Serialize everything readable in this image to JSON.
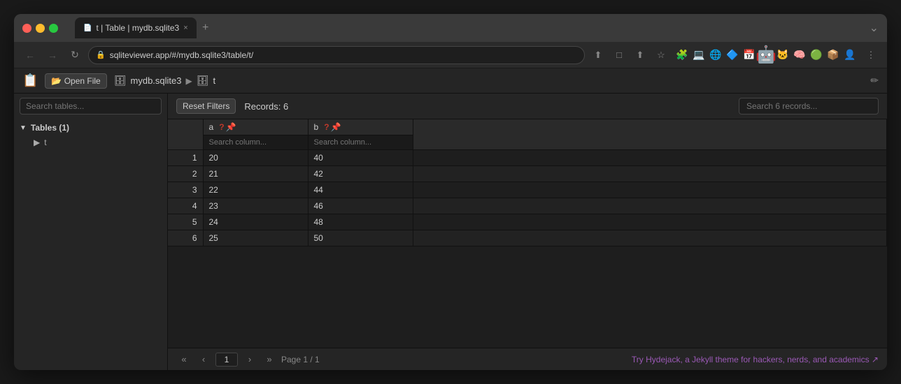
{
  "browser": {
    "tab": {
      "icon": "📄",
      "title": "t | Table | mydb.sqlite3",
      "close": "×"
    },
    "new_tab_label": "+",
    "window_control_label": "⌄",
    "nav": {
      "back": "←",
      "forward": "→",
      "reload": "↻",
      "address": "sqliteviewer.app/#/mydb.sqlite3/table/t/",
      "share1": "⬆",
      "share2": "□",
      "share3": "⬆",
      "star": "☆",
      "more": "⋮"
    }
  },
  "app": {
    "logo": "📋",
    "open_file_label": "📂 Open File",
    "breadcrumb": {
      "db": "mydb.sqlite3",
      "db_icon": "🗄",
      "sep": "▶",
      "table_icon": "🗄",
      "table": "t"
    },
    "edit_icon": "✏"
  },
  "sidebar": {
    "search_placeholder": "Search tables...",
    "tables_group": "Tables (1)",
    "tables": [
      {
        "name": "t"
      }
    ]
  },
  "toolbar": {
    "reset_filters": "Reset Filters",
    "records_count": "Records: 6",
    "search_placeholder": "Search 6 records..."
  },
  "columns": [
    {
      "name": "a",
      "search_placeholder": "Search column...",
      "icon1": "?",
      "icon2": "📌"
    },
    {
      "name": "b",
      "search_placeholder": "Search column...",
      "icon1": "?",
      "icon2": "📌"
    }
  ],
  "rows": [
    {
      "num": "1",
      "a": "20",
      "b": "40"
    },
    {
      "num": "2",
      "a": "21",
      "b": "42"
    },
    {
      "num": "3",
      "a": "22",
      "b": "44"
    },
    {
      "num": "4",
      "a": "23",
      "b": "46"
    },
    {
      "num": "5",
      "a": "24",
      "b": "48"
    },
    {
      "num": "6",
      "a": "25",
      "b": "50"
    }
  ],
  "pagination": {
    "first": "«",
    "prev": "‹",
    "current_page": "1",
    "next": "›",
    "last": "»",
    "page_info": "Page 1 / 1"
  },
  "footer": {
    "link_text": "Try Hydejack, a Jekyll theme for hackers, nerds, and academics ↗"
  }
}
